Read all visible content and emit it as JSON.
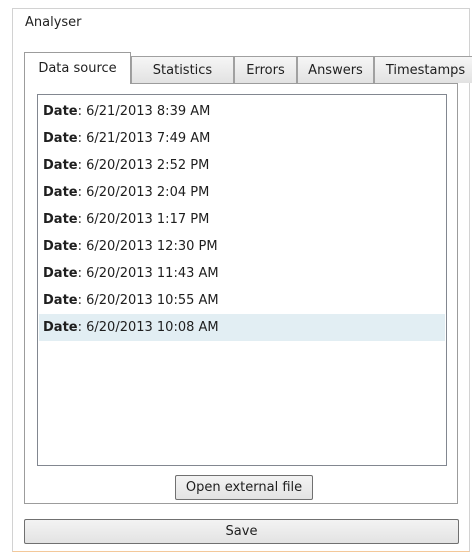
{
  "group": {
    "title": "Analyser"
  },
  "tabs": [
    {
      "label": "Data source"
    },
    {
      "label": "Statistics"
    },
    {
      "label": "Errors"
    },
    {
      "label": "Answers"
    },
    {
      "label": "Timestamps"
    }
  ],
  "list": {
    "key_label": "Date",
    "selected_index": 8,
    "items": [
      "6/21/2013 8:39 AM",
      "6/21/2013 7:49 AM",
      "6/20/2013 2:52 PM",
      "6/20/2013 2:04 PM",
      "6/20/2013 1:17 PM",
      "6/20/2013 12:30 PM",
      "6/20/2013 11:43 AM",
      "6/20/2013 10:55 AM",
      "6/20/2013 10:08 AM"
    ]
  },
  "buttons": {
    "open_external_label": "Open external file",
    "save_label": "Save"
  },
  "colors": {
    "selection": "#e2eef3",
    "outer_bottom_border": "#f3c89a"
  }
}
